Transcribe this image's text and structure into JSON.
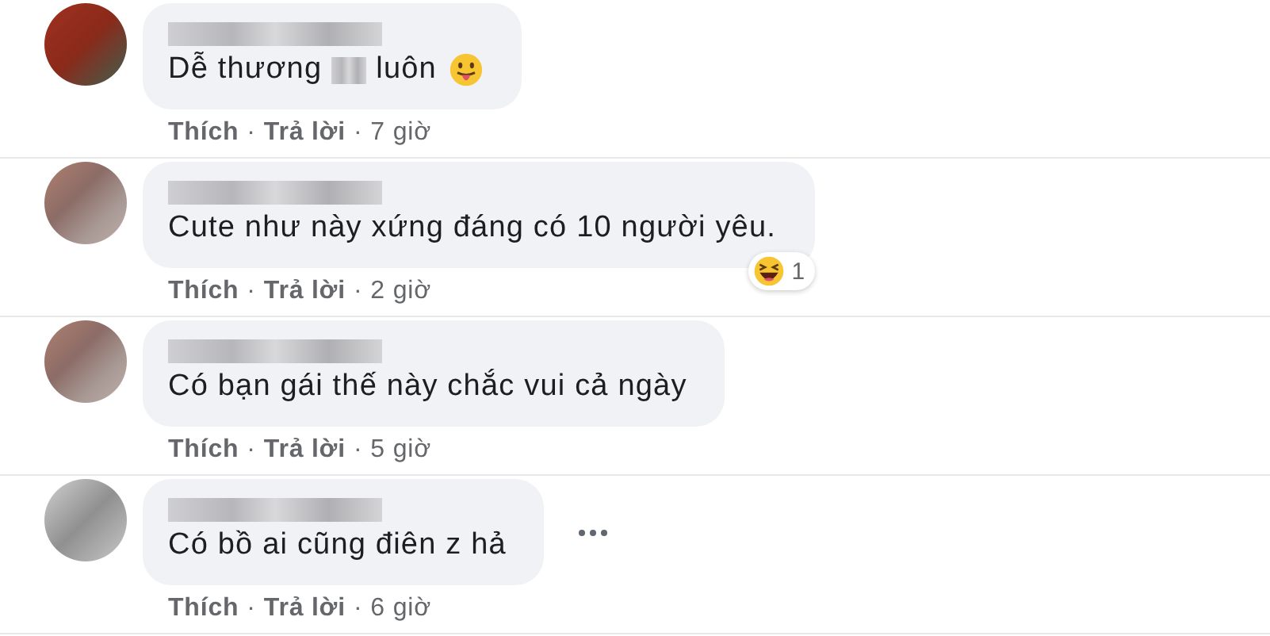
{
  "comments": [
    {
      "segments": [
        {
          "kind": "text",
          "text": "Dễ thương"
        },
        {
          "kind": "redacted"
        },
        {
          "kind": "text",
          "text": "luôn"
        },
        {
          "kind": "emoji"
        }
      ],
      "more_menu": false,
      "actions": [
        "Thích",
        "·",
        "Trả lời",
        "·",
        "7 giờ"
      ]
    },
    {
      "segments": [
        {
          "kind": "text",
          "text": "Cute như này xứng đáng có 10 người yêu."
        }
      ],
      "reaction": {
        "count": "1"
      },
      "more_menu": false,
      "actions": [
        "Thích",
        "·",
        "Trả lời",
        "·",
        "2 giờ"
      ]
    },
    {
      "segments": [
        {
          "kind": "text",
          "text": "Có bạn gái thế này chắc vui cả ngày"
        }
      ],
      "more_menu": false,
      "actions": [
        "Thích",
        "·",
        "Trả lời",
        "·",
        "5 giờ"
      ]
    },
    {
      "segments": [
        {
          "kind": "text",
          "text": "Có bồ ai cũng điên z hả"
        }
      ],
      "more_menu": true,
      "actions": [
        "Thích",
        "·",
        "Trả lời",
        "·",
        "6 giờ"
      ]
    }
  ]
}
